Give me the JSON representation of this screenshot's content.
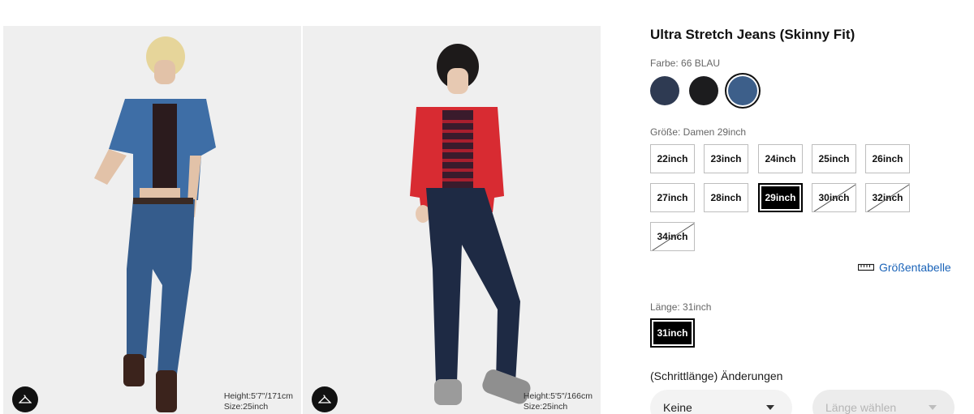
{
  "gallery": {
    "photos": [
      {
        "model_info_line1": "Height:5'7\"/171cm",
        "model_info_line2": "Size:25inch"
      },
      {
        "model_info_line1": "Height:5'5\"/166cm",
        "model_info_line2": "Size:25inch"
      }
    ]
  },
  "product": {
    "title": "Ultra Stretch Jeans (Skinny Fit)",
    "color_label": "Farbe: 66 BLAU",
    "swatches": [
      {
        "name": "navy",
        "color": "#2e3a52"
      },
      {
        "name": "black",
        "color": "#1c1c1e"
      },
      {
        "name": "blue",
        "color": "#3d5f8a"
      }
    ],
    "size_label": "Größe: Damen 29inch",
    "sizes": [
      {
        "label": "22inch",
        "state": "available"
      },
      {
        "label": "23inch",
        "state": "available"
      },
      {
        "label": "24inch",
        "state": "available"
      },
      {
        "label": "25inch",
        "state": "available"
      },
      {
        "label": "26inch",
        "state": "available"
      },
      {
        "label": "27inch",
        "state": "available"
      },
      {
        "label": "28inch",
        "state": "available"
      },
      {
        "label": "29inch",
        "state": "selected"
      },
      {
        "label": "30inch",
        "state": "unavailable"
      },
      {
        "label": "32inch",
        "state": "unavailable"
      },
      {
        "label": "34inch",
        "state": "unavailable"
      }
    ],
    "size_chart_link": "Größentabelle",
    "length_label": "Länge: 31inch",
    "length_option": "31inch",
    "alteration_label": "(Schrittlänge) Änderungen",
    "alteration_select": "Keine",
    "length_select_placeholder": "Länge wählen"
  }
}
